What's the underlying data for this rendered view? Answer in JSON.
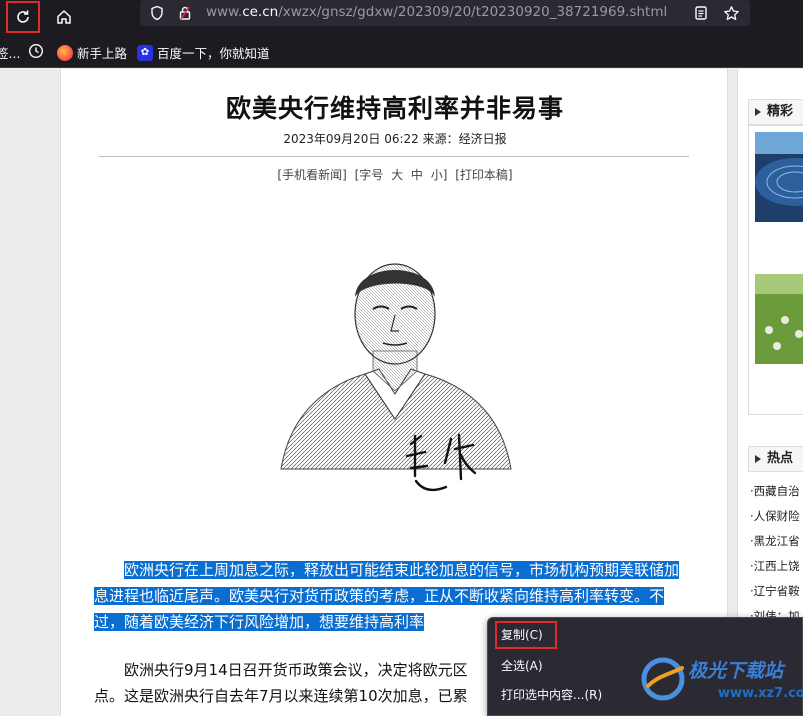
{
  "browser": {
    "url_prefix": "www.",
    "url_host": "ce.cn",
    "url_path": "/xwzx/gnsz/gdxw/202309/20/t20230920_38721969.shtml"
  },
  "bookmarks": [
    {
      "label": "签..."
    },
    {
      "label": "新手上路"
    },
    {
      "label": "百度一下，你就知道"
    }
  ],
  "article": {
    "title": "欧美央行维持高利率并非易事",
    "meta": "2023年09月20日 06:22   来源：经济日报",
    "tools": "[手机看新闻]  [字号 大 中 小]  [打印本稿]",
    "para1_selected": "欧洲央行在上周加息之际，释放出可能结束此轮加息的信号，市场机构预期美联储加息进程也临近尾声。欧美央行对货币政策的考虑，正从不断收紧向维持高利率转变。不过，随着欧美经济下行风险增加，想要维持高利率",
    "para2": "欧洲央行9月14日召开货币政策会议，决定将欧元区",
    "para2_line2": "点。这是欧洲央行自去年7月以来连续第10次加息，已累"
  },
  "sidebar": {
    "section1": "精彩",
    "section2": "热点",
    "hot_items": [
      "·西藏自治",
      "·人保财险",
      "·黑龙江省",
      "·江西上饶",
      "·辽宁省鞍",
      "·刘伟：加"
    ]
  },
  "context_menu": {
    "copy": "复制(C)",
    "select_all": "全选(A)",
    "print_selection": "打印选中内容...(R)"
  },
  "watermark": {
    "text": "极光下载站",
    "url": "www.xz7.com"
  }
}
